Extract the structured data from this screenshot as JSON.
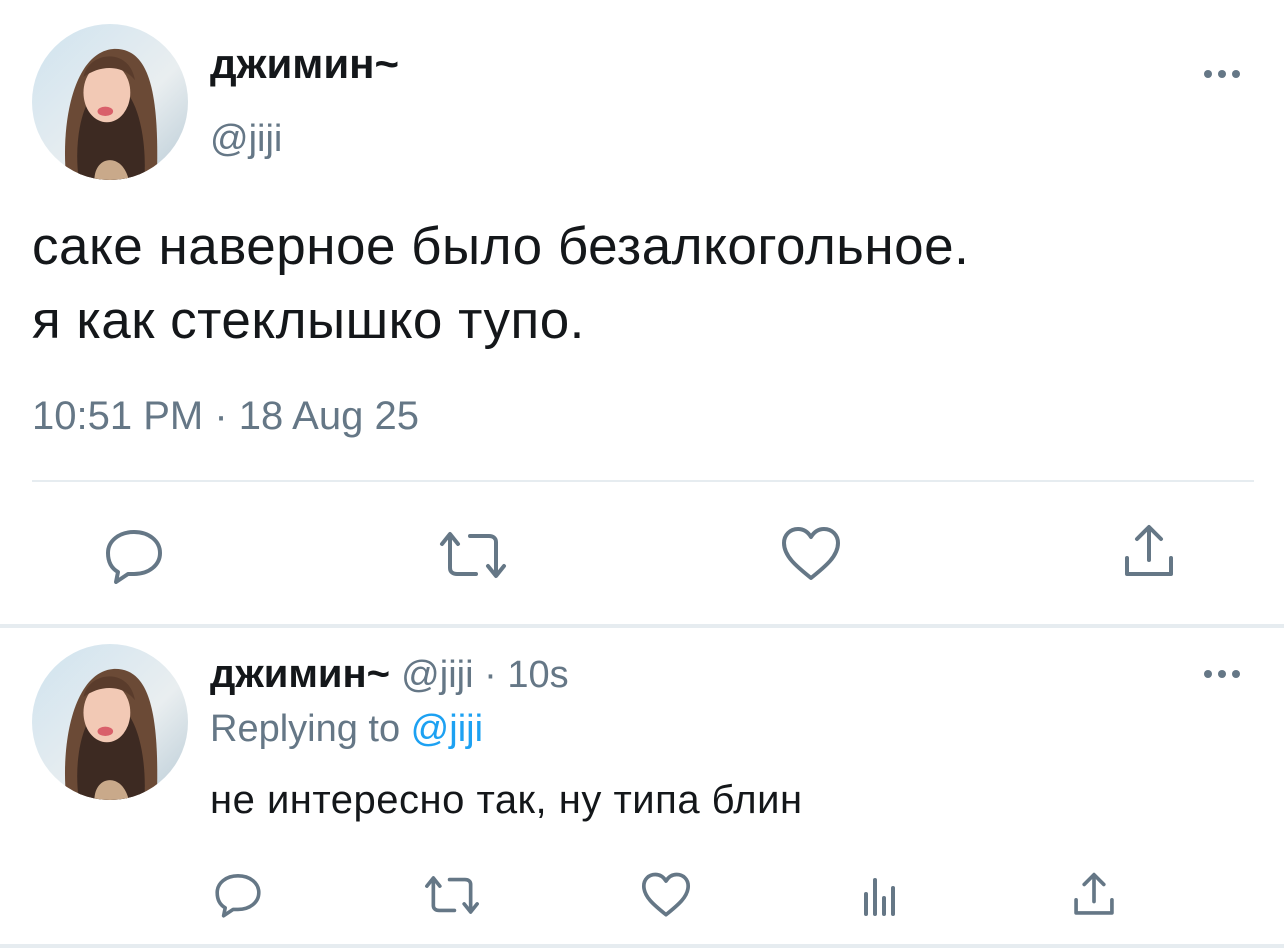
{
  "main_tweet": {
    "display_name": "джимин~",
    "handle": "@jiji",
    "text_lines": [
      "саке наверное было безалкогольное.",
      "я как стеклышко тупо."
    ],
    "timestamp": "10:51 PM · 18 Aug 25",
    "actions": [
      "reply-icon",
      "retweet-icon",
      "like-icon",
      "share-icon"
    ]
  },
  "reply_tweet": {
    "display_name": "джимин~",
    "handle": "@jiji",
    "separator": " · ",
    "age": "10s",
    "replying_prefix": "Replying to ",
    "replying_to": "@jiji",
    "text": "не интересно так, ну типа блин",
    "actions": [
      "reply-icon",
      "retweet-icon",
      "like-icon",
      "analytics-icon",
      "share-icon"
    ]
  },
  "colors": {
    "text_primary": "#14171a",
    "text_secondary": "#657786",
    "accent": "#1da1f2",
    "divider": "#e6ecf0"
  }
}
